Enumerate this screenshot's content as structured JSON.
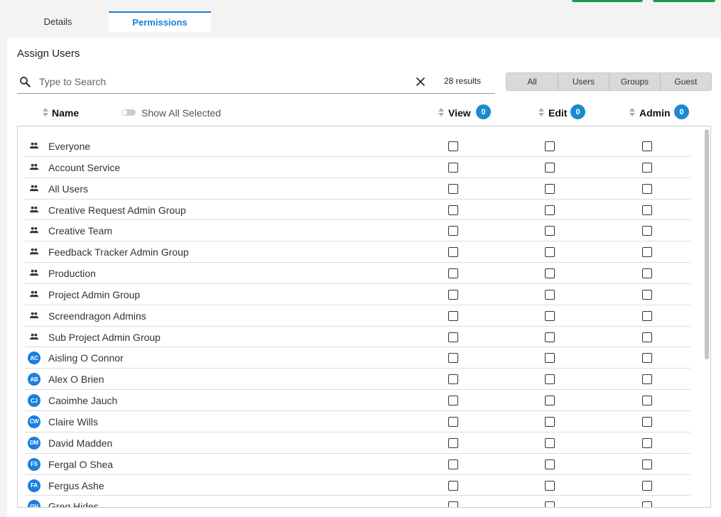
{
  "tabs": [
    {
      "label": "Details"
    },
    {
      "label": "Permissions",
      "active": true
    }
  ],
  "section_title": "Assign Users",
  "search": {
    "placeholder": "Type to Search",
    "value": ""
  },
  "results_text": "28 results",
  "filters": [
    "All",
    "Users",
    "Groups",
    "Guest"
  ],
  "columns": {
    "name": "Name",
    "show_all_selected": "Show All Selected",
    "view": {
      "label": "View",
      "count": "0"
    },
    "edit": {
      "label": "Edit",
      "count": "0"
    },
    "admin": {
      "label": "Admin",
      "count": "0"
    }
  },
  "rows": [
    {
      "type": "group",
      "name": "Everyone"
    },
    {
      "type": "group",
      "name": "Account Service"
    },
    {
      "type": "group",
      "name": "All Users"
    },
    {
      "type": "group",
      "name": "Creative Request Admin Group"
    },
    {
      "type": "group",
      "name": "Creative Team"
    },
    {
      "type": "group",
      "name": "Feedback Tracker Admin Group"
    },
    {
      "type": "group",
      "name": "Production"
    },
    {
      "type": "group",
      "name": "Project Admin Group"
    },
    {
      "type": "group",
      "name": "Screendragon Admins"
    },
    {
      "type": "group",
      "name": "Sub Project Admin Group"
    },
    {
      "type": "user",
      "initials": "AC",
      "name": "Aisling O Connor"
    },
    {
      "type": "user",
      "initials": "AB",
      "name": "Alex O Brien"
    },
    {
      "type": "user",
      "initials": "CJ",
      "name": "Caoimhe Jauch"
    },
    {
      "type": "user",
      "initials": "CW",
      "name": "Claire Wills"
    },
    {
      "type": "user",
      "initials": "DM",
      "name": "David Madden"
    },
    {
      "type": "user",
      "initials": "FS",
      "name": "Fergal O Shea"
    },
    {
      "type": "user",
      "initials": "FA",
      "name": "Fergus Ashe"
    },
    {
      "type": "user",
      "initials": "GH",
      "name": "Greg Hides"
    }
  ],
  "colors": {
    "accent": "#1c7ed6",
    "badge": "#1a8ad0",
    "avatar": "#1a7fe0",
    "primary_button": "#1a9a4a"
  }
}
